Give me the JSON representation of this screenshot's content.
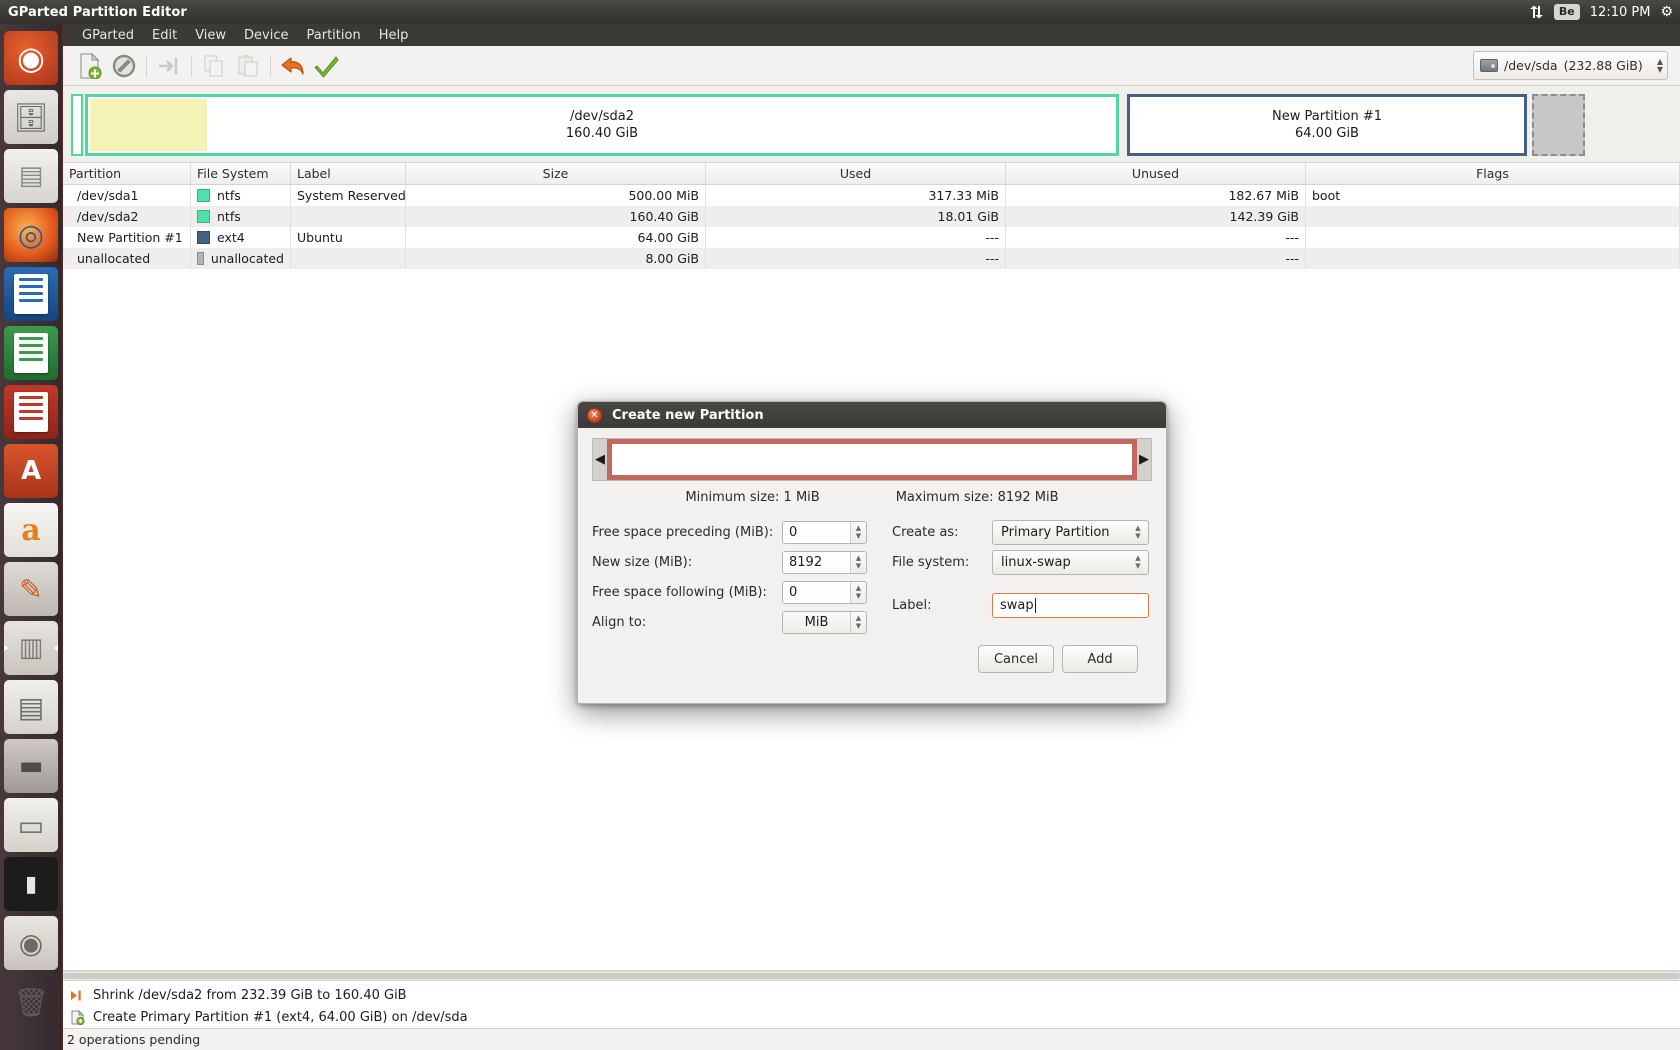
{
  "top_panel": {
    "title": "GParted Partition Editor",
    "indicators": {
      "sync_icon": "sync-arrows-icon",
      "keyboard": "Be",
      "clock": "12:10 PM",
      "gear_icon": "gear-icon"
    }
  },
  "launcher": {
    "items": [
      {
        "name": "ubuntu-dash",
        "glyph": "◉"
      },
      {
        "name": "files",
        "glyph": "🗄"
      },
      {
        "name": "archive-manager",
        "glyph": "▤"
      },
      {
        "name": "firefox",
        "glyph": "◎"
      },
      {
        "name": "libreoffice-writer",
        "glyph": ""
      },
      {
        "name": "libreoffice-calc",
        "glyph": ""
      },
      {
        "name": "libreoffice-impress",
        "glyph": ""
      },
      {
        "name": "ubuntu-software",
        "glyph": "A"
      },
      {
        "name": "amazon",
        "glyph": "a"
      },
      {
        "name": "system-settings",
        "glyph": "✎"
      },
      {
        "name": "gparted",
        "glyph": "▥"
      },
      {
        "name": "floppy-disk",
        "glyph": "▤"
      },
      {
        "name": "hard-disk",
        "glyph": "▬"
      },
      {
        "name": "disk-image",
        "glyph": "▭"
      },
      {
        "name": "terminal",
        "glyph": "▮"
      },
      {
        "name": "cd-drive",
        "glyph": "◉"
      },
      {
        "name": "trash",
        "glyph": "🗑"
      }
    ]
  },
  "menubar": {
    "items": [
      "GParted",
      "Edit",
      "View",
      "Device",
      "Partition",
      "Help"
    ]
  },
  "toolbar": {
    "buttons": [
      {
        "name": "new-partition-button",
        "icon": "new-document-icon",
        "enabled": true
      },
      {
        "name": "delete-partition-button",
        "icon": "no-entry-icon",
        "enabled": true
      },
      {
        "name": "resize-move-button",
        "icon": "resize-arrow-icon",
        "enabled": false
      },
      {
        "name": "copy-button",
        "icon": "copy-icon",
        "enabled": false
      },
      {
        "name": "paste-button",
        "icon": "paste-icon",
        "enabled": false
      },
      {
        "name": "undo-button",
        "icon": "undo-arrow-icon",
        "enabled": true
      },
      {
        "name": "apply-button",
        "icon": "green-check-icon",
        "enabled": true
      }
    ],
    "device_selector": {
      "device": "/dev/sda",
      "size": "(232.88 GiB)"
    }
  },
  "graphic_bar": {
    "partitions": [
      {
        "name": "/dev/sda1",
        "label_line1": "",
        "label_line2": "",
        "border": "#4ed8a0"
      },
      {
        "name": "/dev/sda2",
        "label_line1": "/dev/sda2",
        "label_line2": "160.40 GiB",
        "border": "#4ed8a0"
      },
      {
        "name": "New Partition #1",
        "label_line1": "New Partition #1",
        "label_line2": "64.00 GiB",
        "border": "#45617f"
      },
      {
        "name": "unallocated",
        "label_line1": "",
        "label_line2": "",
        "border": "#8d8d8d"
      }
    ]
  },
  "table": {
    "headers": [
      "Partition",
      "File System",
      "Label",
      "Size",
      "Used",
      "Unused",
      "Flags"
    ],
    "rows": [
      {
        "partition": "/dev/sda1",
        "filesystem": "ntfs",
        "fs_class": "fs-ntfs",
        "label": "System Reserved",
        "size": "500.00 MiB",
        "used": "317.33 MiB",
        "unused": "182.67 MiB",
        "flags": "boot"
      },
      {
        "partition": "/dev/sda2",
        "filesystem": "ntfs",
        "fs_class": "fs-ntfs",
        "label": "",
        "size": "160.40 GiB",
        "used": "18.01 GiB",
        "unused": "142.39 GiB",
        "flags": ""
      },
      {
        "partition": "New Partition #1",
        "filesystem": "ext4",
        "fs_class": "fs-ext4",
        "label": "Ubuntu",
        "size": "64.00 GiB",
        "used": "---",
        "unused": "---",
        "flags": ""
      },
      {
        "partition": "unallocated",
        "filesystem": "unallocated",
        "fs_class": "fs-unalloc",
        "label": "",
        "size": "8.00 GiB",
        "used": "---",
        "unused": "---",
        "flags": ""
      }
    ]
  },
  "operations": {
    "items": [
      {
        "icon": "shrink-icon",
        "text": "Shrink /dev/sda2 from 232.39 GiB to 160.40 GiB"
      },
      {
        "icon": "create-partition-icon",
        "text": "Create Primary Partition #1 (ext4, 64.00 GiB) on /dev/sda"
      }
    ],
    "status": "2 operations pending"
  },
  "dialog": {
    "title": "Create new Partition",
    "close_icon": "close-icon",
    "minimum_size": "Minimum size: 1 MiB",
    "maximum_size": "Maximum size: 8192 MiB",
    "fields": {
      "free_preceding_label": "Free space preceding (MiB):",
      "free_preceding_value": "0",
      "new_size_label": "New size (MiB):",
      "new_size_value": "8192",
      "free_following_label": "Free space following (MiB):",
      "free_following_value": "0",
      "align_to_label": "Align to:",
      "align_to_value": "MiB",
      "create_as_label": "Create as:",
      "create_as_value": "Primary Partition",
      "file_system_label": "File system:",
      "file_system_value": "linux-swap",
      "partition_label_label": "Label:",
      "partition_label_value": "swap"
    },
    "buttons": {
      "cancel": "Cancel",
      "add": "Add"
    }
  },
  "colors": {
    "ntfs": "#4fe1a7",
    "ext4": "#45617f",
    "unallocated": "#b5b5b5",
    "used_yellow": "#f5f2b8",
    "resize_handle": "#c06a5f",
    "focus_orange": "#e07b42"
  }
}
